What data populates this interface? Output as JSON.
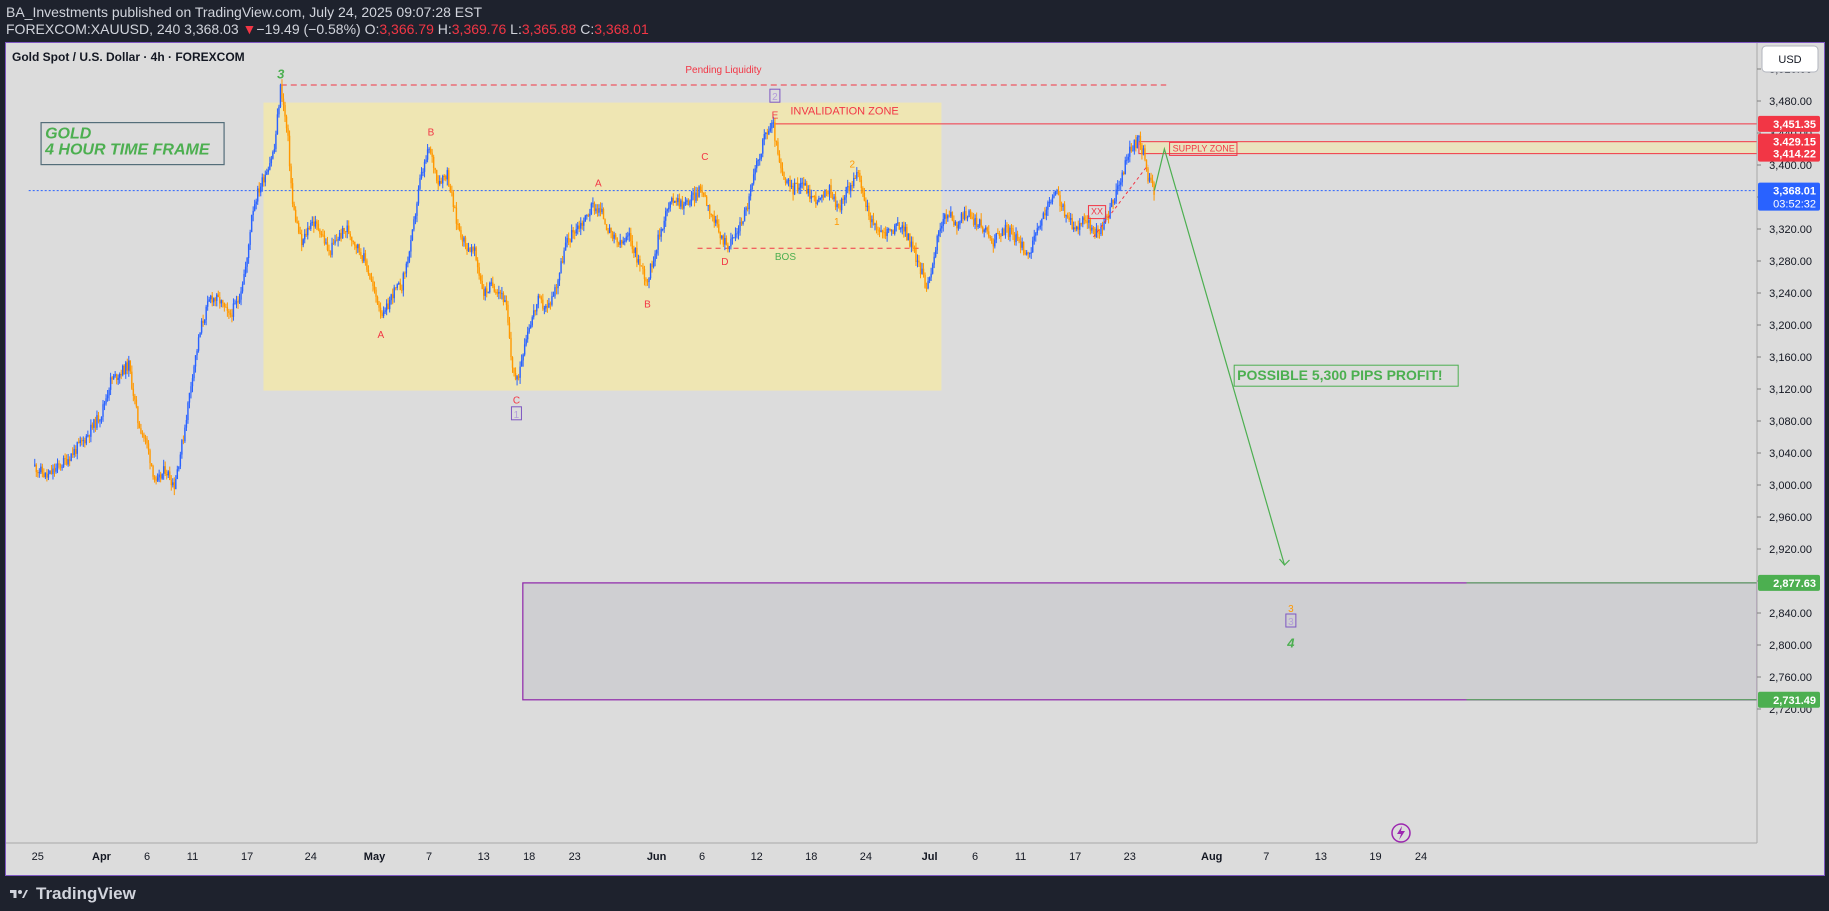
{
  "header": {
    "publisher": "BA_Investments",
    "published_text": "published on TradingView.com, July 24, 2025 09:07:28 EST",
    "symbol": "FOREXCOM:XAUUSD, 240",
    "last": "3,368.03",
    "change_arrow": "▼",
    "change": "−19.49 (−0.58%)",
    "o_label": "O:",
    "o": "3,366.79",
    "h_label": "H:",
    "h": "3,369.76",
    "l_label": "L:",
    "l": "3,365.88",
    "c_label": "C:",
    "c": "3,368.01"
  },
  "chart_title": "Gold Spot / U.S. Dollar · 4h · FOREXCOM",
  "currency_button": "USD",
  "footer": {
    "brand": "TradingView"
  },
  "chart_data": {
    "type": "candlestick",
    "ylim": [
      2700,
      3525
    ],
    "y_ticks": [
      2720,
      2760,
      2800,
      2840,
      2880,
      2920,
      2960,
      3000,
      3040,
      3080,
      3120,
      3160,
      3200,
      3240,
      3280,
      3320,
      3360,
      3400,
      3440,
      3480,
      3520
    ],
    "y_tick_labels": [
      "2,720.00",
      "2,760.00",
      "2,800.00",
      "2,840.00",
      "2,880.00",
      "2,920.00",
      "2,960.00",
      "3,000.00",
      "3,040.00",
      "3,080.00",
      "3,120.00",
      "3,160.00",
      "3,200.00",
      "3,240.00",
      "3,280.00",
      "3,320.00",
      "3,360.00",
      "3,400.00",
      "3,440.00",
      "3,480.00",
      "3,520.00"
    ],
    "x_labels": [
      {
        "label": "25",
        "day": -7
      },
      {
        "label": "Apr",
        "day": 0
      },
      {
        "label": "6",
        "day": 5
      },
      {
        "label": "11",
        "day": 10
      },
      {
        "label": "17",
        "day": 16
      },
      {
        "label": "24",
        "day": 23
      },
      {
        "label": "May",
        "day": 30
      },
      {
        "label": "7",
        "day": 36
      },
      {
        "label": "13",
        "day": 42
      },
      {
        "label": "18",
        "day": 47
      },
      {
        "label": "23",
        "day": 52
      },
      {
        "label": "Jun",
        "day": 61
      },
      {
        "label": "6",
        "day": 66
      },
      {
        "label": "12",
        "day": 72
      },
      {
        "label": "18",
        "day": 78
      },
      {
        "label": "24",
        "day": 84
      },
      {
        "label": "Jul",
        "day": 91
      },
      {
        "label": "6",
        "day": 96
      },
      {
        "label": "11",
        "day": 101
      },
      {
        "label": "17",
        "day": 107
      },
      {
        "label": "23",
        "day": 113
      },
      {
        "label": "Aug",
        "day": 122
      },
      {
        "label": "7",
        "day": 128
      },
      {
        "label": "13",
        "day": 134
      },
      {
        "label": "19",
        "day": 140
      },
      {
        "label": "24",
        "day": 145
      }
    ],
    "price_path": [
      [
        -7.5,
        3025
      ],
      [
        -6,
        3010
      ],
      [
        -4,
        3030
      ],
      [
        -2,
        3055
      ],
      [
        0,
        3090
      ],
      [
        1,
        3130
      ],
      [
        2,
        3140
      ],
      [
        3,
        3150
      ],
      [
        4,
        3080
      ],
      [
        5,
        3050
      ],
      [
        6,
        3000
      ],
      [
        7,
        3020
      ],
      [
        8,
        3000
      ],
      [
        9,
        3060
      ],
      [
        10,
        3140
      ],
      [
        11,
        3200
      ],
      [
        12,
        3235
      ],
      [
        13,
        3230
      ],
      [
        14,
        3210
      ],
      [
        15,
        3230
      ],
      [
        16,
        3280
      ],
      [
        16.5,
        3340
      ],
      [
        17,
        3360
      ],
      [
        18,
        3390
      ],
      [
        19,
        3420
      ],
      [
        19.7,
        3500
      ],
      [
        20.5,
        3430
      ],
      [
        21,
        3350
      ],
      [
        22,
        3300
      ],
      [
        23,
        3330
      ],
      [
        24,
        3320
      ],
      [
        25,
        3290
      ],
      [
        26,
        3310
      ],
      [
        27,
        3320
      ],
      [
        28,
        3300
      ],
      [
        29,
        3280
      ],
      [
        30,
        3240
      ],
      [
        31,
        3210
      ],
      [
        32,
        3240
      ],
      [
        33,
        3250
      ],
      [
        34,
        3300
      ],
      [
        35,
        3380
      ],
      [
        36,
        3420
      ],
      [
        37,
        3380
      ],
      [
        38,
        3390
      ],
      [
        39,
        3330
      ],
      [
        40,
        3300
      ],
      [
        41,
        3290
      ],
      [
        42,
        3240
      ],
      [
        43,
        3250
      ],
      [
        44,
        3240
      ],
      [
        44.5,
        3220
      ],
      [
        45,
        3160
      ],
      [
        45.6,
        3125
      ],
      [
        46.5,
        3180
      ],
      [
        47,
        3200
      ],
      [
        48,
        3230
      ],
      [
        49,
        3220
      ],
      [
        50,
        3250
      ],
      [
        51,
        3300
      ],
      [
        52,
        3320
      ],
      [
        53,
        3330
      ],
      [
        54,
        3350
      ],
      [
        55,
        3340
      ],
      [
        56,
        3310
      ],
      [
        57,
        3300
      ],
      [
        58,
        3310
      ],
      [
        59,
        3280
      ],
      [
        60,
        3255
      ],
      [
        61,
        3300
      ],
      [
        62,
        3340
      ],
      [
        63,
        3360
      ],
      [
        64,
        3350
      ],
      [
        65,
        3360
      ],
      [
        66,
        3370
      ],
      [
        67,
        3340
      ],
      [
        68,
        3310
      ],
      [
        69,
        3300
      ],
      [
        70,
        3320
      ],
      [
        71,
        3350
      ],
      [
        72,
        3400
      ],
      [
        73,
        3440
      ],
      [
        73.8,
        3450
      ],
      [
        74.5,
        3400
      ],
      [
        75,
        3380
      ],
      [
        76,
        3370
      ],
      [
        77,
        3380
      ],
      [
        78,
        3360
      ],
      [
        79,
        3355
      ],
      [
        80,
        3370
      ],
      [
        81,
        3345
      ],
      [
        82,
        3370
      ],
      [
        83,
        3390
      ],
      [
        84,
        3350
      ],
      [
        85,
        3320
      ],
      [
        86,
        3315
      ],
      [
        87,
        3320
      ],
      [
        88,
        3325
      ],
      [
        89,
        3300
      ],
      [
        90,
        3270
      ],
      [
        90.6,
        3250
      ],
      [
        91.5,
        3280
      ],
      [
        92,
        3320
      ],
      [
        93,
        3340
      ],
      [
        94,
        3325
      ],
      [
        95,
        3340
      ],
      [
        96,
        3330
      ],
      [
        97,
        3320
      ],
      [
        98,
        3305
      ],
      [
        99,
        3320
      ],
      [
        100,
        3315
      ],
      [
        101,
        3300
      ],
      [
        102,
        3290
      ],
      [
        103,
        3320
      ],
      [
        104,
        3350
      ],
      [
        105,
        3365
      ],
      [
        106,
        3335
      ],
      [
        107,
        3320
      ],
      [
        108,
        3335
      ],
      [
        109,
        3315
      ],
      [
        110,
        3320
      ],
      [
        111,
        3350
      ],
      [
        112,
        3380
      ],
      [
        113,
        3420
      ],
      [
        114,
        3430
      ],
      [
        114.5,
        3415
      ],
      [
        115,
        3385
      ],
      [
        115.7,
        3368
      ]
    ],
    "highlight_box": {
      "x_from": 17.8,
      "x_to": 92.3,
      "y_from": 3118,
      "y_to": 3478,
      "color": "#f5e9a6"
    },
    "target_box": {
      "x_from": 46.3,
      "x_to": 150,
      "y_from": 2731.49,
      "y_to": 2877.63
    },
    "levels": [
      {
        "name": "invalidation",
        "price": 3451.35,
        "label": "3,451.35",
        "color": "#f23645",
        "from": 74
      },
      {
        "name": "supply-top",
        "price": 3429.15,
        "label": "3,429.15",
        "color": "#f23645",
        "from": 114
      },
      {
        "name": "supply-bottom",
        "price": 3414.22,
        "label": "3,414.22",
        "color": "#f23645",
        "from": 114
      },
      {
        "name": "current",
        "price": 3368.01,
        "label": "3,368.01",
        "sublabel": "03:52:32",
        "color": "#2962ff",
        "from": -8
      },
      {
        "name": "target-top",
        "price": 2877.63,
        "label": "2,877.63",
        "color": "#4caf50",
        "from": 150
      },
      {
        "name": "target-bottom",
        "price": 2731.49,
        "label": "2,731.49",
        "color": "#4caf50",
        "from": 150
      }
    ],
    "pending_liquidity": {
      "text": "Pending Liquidity",
      "price": 3500,
      "x_from": 19.7,
      "x_to": 117
    },
    "bos": {
      "text": "BOS",
      "price": 3296,
      "x_from": 65.5,
      "x_to": 90
    },
    "projection": [
      [
        115.7,
        3368
      ],
      [
        116.8,
        3420
      ],
      [
        130,
        2900
      ]
    ],
    "annotations": [
      {
        "text": "3",
        "x": 19.7,
        "y": 3513,
        "color": "#4caf50",
        "style": "wave"
      },
      {
        "text": "A",
        "x": 30.7,
        "y": 3189,
        "color": "#f23645"
      },
      {
        "text": "B",
        "x": 36.2,
        "y": 3442,
        "color": "#f23645"
      },
      {
        "text": "C",
        "x": 45.6,
        "y": 3107,
        "color": "#f23645"
      },
      {
        "text": "1",
        "x": 45.6,
        "y": 3089,
        "color": "#b39ddb",
        "style": "box"
      },
      {
        "text": "A",
        "x": 54.6,
        "y": 3378,
        "color": "#f23645"
      },
      {
        "text": "B",
        "x": 60,
        "y": 3227,
        "color": "#f23645"
      },
      {
        "text": "C",
        "x": 66.3,
        "y": 3411,
        "color": "#f23645"
      },
      {
        "text": "D",
        "x": 68.5,
        "y": 3280,
        "color": "#f23645"
      },
      {
        "text": "E",
        "x": 74,
        "y": 3463,
        "color": "#f23645"
      },
      {
        "text": "2",
        "x": 74,
        "y": 3486,
        "color": "#b39ddb",
        "style": "box"
      },
      {
        "text": "2",
        "x": 82.5,
        "y": 3402,
        "color": "#ff9800"
      },
      {
        "text": "1",
        "x": 80.8,
        "y": 3330,
        "color": "#ff9800"
      },
      {
        "text": "3",
        "x": 130.7,
        "y": 2846,
        "color": "#ff9800"
      },
      {
        "text": "3",
        "x": 130.7,
        "y": 2830,
        "color": "#b39ddb",
        "style": "box"
      },
      {
        "text": "4",
        "x": 130.7,
        "y": 2802,
        "color": "#4caf50",
        "style": "wave"
      }
    ],
    "zone_labels": [
      {
        "text": "INVALIDATION ZONE",
        "x": 75.7,
        "y": 3463,
        "color": "#f23645",
        "size": 11
      },
      {
        "text": "SUPPLY ZONE",
        "x": 117.7,
        "y": 3417,
        "color": "#f23645",
        "size": 9,
        "style": "boxed"
      },
      {
        "text": "XX",
        "x": 109.4,
        "y": 3338,
        "color": "#f23645",
        "size": 9,
        "style": "boxed"
      },
      {
        "text": "BOS",
        "x": 74,
        "y": 3281,
        "color": "#4caf50",
        "size": 10
      }
    ],
    "callouts": [
      {
        "text": "GOLD",
        "x": -6.2,
        "y": 3433,
        "color": "#4caf50"
      },
      {
        "text": "4 HOUR TIME FRAME",
        "x": -6.2,
        "y": 3413,
        "color": "#4caf50"
      },
      {
        "text": "POSSIBLE 5,300 PIPS PROFIT!",
        "x": 124.8,
        "y": 3131,
        "color": "#4caf50"
      }
    ]
  }
}
